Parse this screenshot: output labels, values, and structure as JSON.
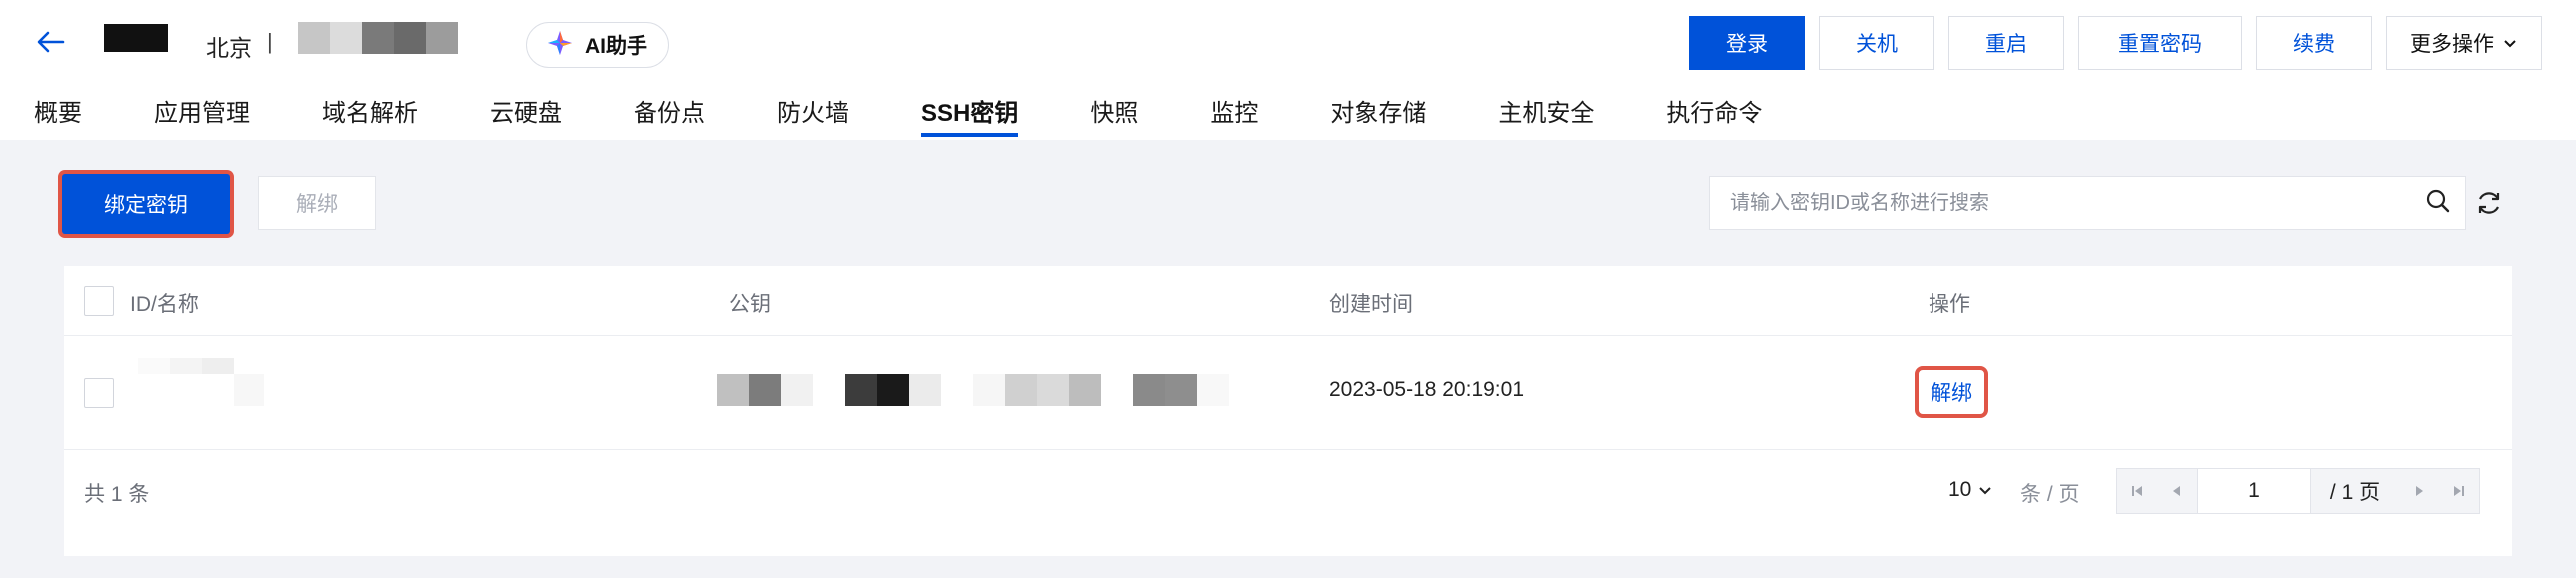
{
  "header": {
    "region": "北京",
    "separator": "|",
    "ai_assistant": "AI助手",
    "actions": {
      "login": "登录",
      "shutdown": "关机",
      "restart": "重启",
      "reset_password": "重置密码",
      "renew": "续费",
      "more": "更多操作"
    }
  },
  "tabs": [
    "概要",
    "应用管理",
    "域名解析",
    "云硬盘",
    "备份点",
    "防火墙",
    "SSH密钥",
    "快照",
    "监控",
    "对象存储",
    "主机安全",
    "执行命令"
  ],
  "active_tab": "SSH密钥",
  "toolbar": {
    "bind_key": "绑定密钥",
    "unbind": "解绑",
    "search_placeholder": "请输入密钥ID或名称进行搜索"
  },
  "table": {
    "columns": {
      "id_name": "ID/名称",
      "public_key": "公钥",
      "created_at": "创建时间",
      "operation": "操作"
    },
    "rows": [
      {
        "created_at": "2023-05-18 20:19:01",
        "action": "解绑"
      }
    ]
  },
  "pagination": {
    "total": "共 1 条",
    "page_size": "10",
    "page_size_unit": "条 / 页",
    "current_page": "1",
    "total_pages": "/ 1 页"
  },
  "colors": {
    "primary": "#0052d9",
    "highlight_border": "#e05546",
    "background": "#f2f3f7"
  },
  "icons": [
    "back-arrow-icon",
    "ai-logo-icon",
    "chevron-down-icon",
    "search-icon",
    "refresh-icon",
    "first-page-icon",
    "prev-page-icon",
    "next-page-icon",
    "last-page-icon"
  ]
}
